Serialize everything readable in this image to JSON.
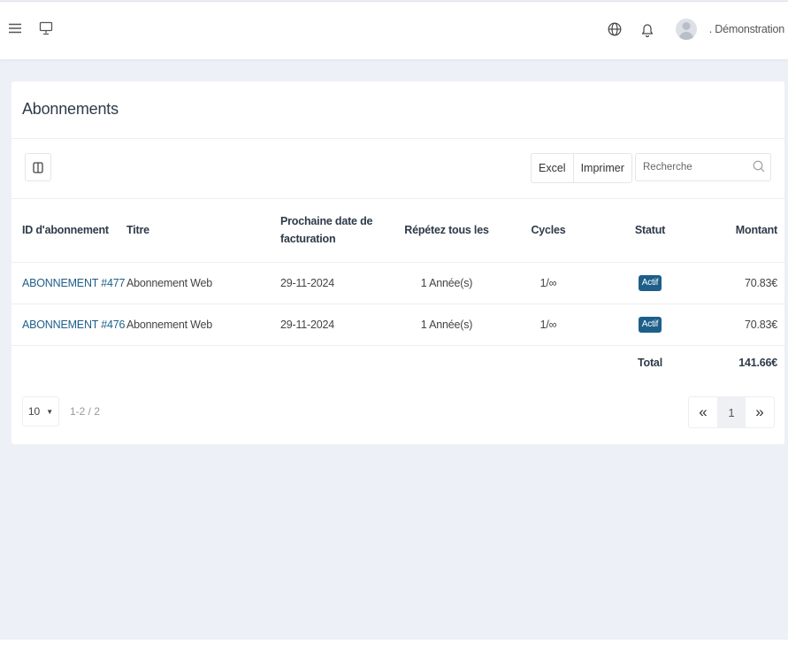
{
  "header": {
    "menu_icon": "hamburger-icon",
    "screen_icon": "monitor-icon",
    "language_icon": "globe-icon",
    "notification_icon": "bell-icon",
    "username": ". Démonstration"
  },
  "card": {
    "title": "Abonnements",
    "toolbar": {
      "excel_label": "Excel",
      "print_label": "Imprimer",
      "search_placeholder": "Recherche"
    },
    "table": {
      "columns": [
        "ID d'abonnement",
        "Titre",
        "Prochaine date de facturation",
        "Répétez tous les",
        "Cycles",
        "Statut",
        "Montant"
      ],
      "rows": [
        {
          "id": "ABONNEMENT #477",
          "title": "Abonnement Web",
          "next_date": "29-11-2024",
          "repeat": "1 Année(s)",
          "cycles": "1/∞",
          "status": "Actif",
          "amount": "70.83€"
        },
        {
          "id": "ABONNEMENT #476",
          "title": "Abonnement Web",
          "next_date": "29-11-2024",
          "repeat": "1 Année(s)",
          "cycles": "1/∞",
          "status": "Actif",
          "amount": "70.83€"
        }
      ],
      "total_label": "Total",
      "total_amount": "141.66€"
    },
    "pager": {
      "page_size": "10",
      "info": "1-2 / 2",
      "prev": "«",
      "current_page": "1",
      "next": "»"
    }
  },
  "colors": {
    "accent": "#1e5f8a",
    "background": "#eef0f8"
  }
}
